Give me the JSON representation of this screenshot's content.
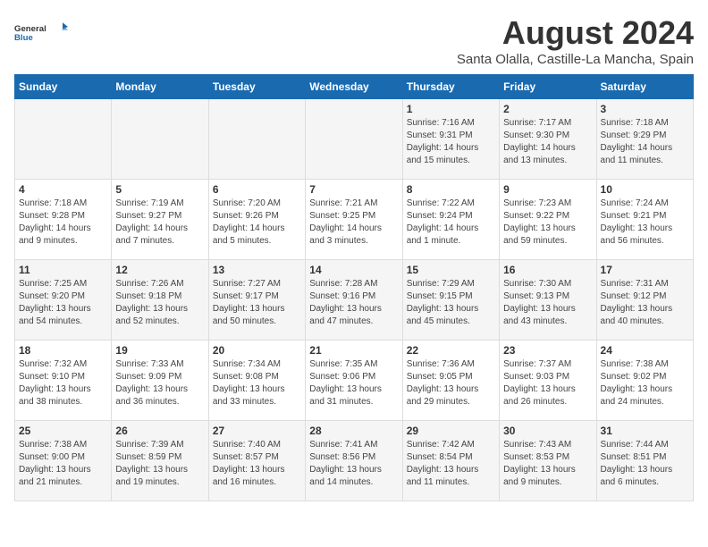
{
  "header": {
    "logo_general": "General",
    "logo_blue": "Blue",
    "month_year": "August 2024",
    "location": "Santa Olalla, Castille-La Mancha, Spain"
  },
  "days_of_week": [
    "Sunday",
    "Monday",
    "Tuesday",
    "Wednesday",
    "Thursday",
    "Friday",
    "Saturday"
  ],
  "weeks": [
    [
      {
        "day": "",
        "info": ""
      },
      {
        "day": "",
        "info": ""
      },
      {
        "day": "",
        "info": ""
      },
      {
        "day": "",
        "info": ""
      },
      {
        "day": "1",
        "info": "Sunrise: 7:16 AM\nSunset: 9:31 PM\nDaylight: 14 hours and 15 minutes."
      },
      {
        "day": "2",
        "info": "Sunrise: 7:17 AM\nSunset: 9:30 PM\nDaylight: 14 hours and 13 minutes."
      },
      {
        "day": "3",
        "info": "Sunrise: 7:18 AM\nSunset: 9:29 PM\nDaylight: 14 hours and 11 minutes."
      }
    ],
    [
      {
        "day": "4",
        "info": "Sunrise: 7:18 AM\nSunset: 9:28 PM\nDaylight: 14 hours and 9 minutes."
      },
      {
        "day": "5",
        "info": "Sunrise: 7:19 AM\nSunset: 9:27 PM\nDaylight: 14 hours and 7 minutes."
      },
      {
        "day": "6",
        "info": "Sunrise: 7:20 AM\nSunset: 9:26 PM\nDaylight: 14 hours and 5 minutes."
      },
      {
        "day": "7",
        "info": "Sunrise: 7:21 AM\nSunset: 9:25 PM\nDaylight: 14 hours and 3 minutes."
      },
      {
        "day": "8",
        "info": "Sunrise: 7:22 AM\nSunset: 9:24 PM\nDaylight: 14 hours and 1 minute."
      },
      {
        "day": "9",
        "info": "Sunrise: 7:23 AM\nSunset: 9:22 PM\nDaylight: 13 hours and 59 minutes."
      },
      {
        "day": "10",
        "info": "Sunrise: 7:24 AM\nSunset: 9:21 PM\nDaylight: 13 hours and 56 minutes."
      }
    ],
    [
      {
        "day": "11",
        "info": "Sunrise: 7:25 AM\nSunset: 9:20 PM\nDaylight: 13 hours and 54 minutes."
      },
      {
        "day": "12",
        "info": "Sunrise: 7:26 AM\nSunset: 9:18 PM\nDaylight: 13 hours and 52 minutes."
      },
      {
        "day": "13",
        "info": "Sunrise: 7:27 AM\nSunset: 9:17 PM\nDaylight: 13 hours and 50 minutes."
      },
      {
        "day": "14",
        "info": "Sunrise: 7:28 AM\nSunset: 9:16 PM\nDaylight: 13 hours and 47 minutes."
      },
      {
        "day": "15",
        "info": "Sunrise: 7:29 AM\nSunset: 9:15 PM\nDaylight: 13 hours and 45 minutes."
      },
      {
        "day": "16",
        "info": "Sunrise: 7:30 AM\nSunset: 9:13 PM\nDaylight: 13 hours and 43 minutes."
      },
      {
        "day": "17",
        "info": "Sunrise: 7:31 AM\nSunset: 9:12 PM\nDaylight: 13 hours and 40 minutes."
      }
    ],
    [
      {
        "day": "18",
        "info": "Sunrise: 7:32 AM\nSunset: 9:10 PM\nDaylight: 13 hours and 38 minutes."
      },
      {
        "day": "19",
        "info": "Sunrise: 7:33 AM\nSunset: 9:09 PM\nDaylight: 13 hours and 36 minutes."
      },
      {
        "day": "20",
        "info": "Sunrise: 7:34 AM\nSunset: 9:08 PM\nDaylight: 13 hours and 33 minutes."
      },
      {
        "day": "21",
        "info": "Sunrise: 7:35 AM\nSunset: 9:06 PM\nDaylight: 13 hours and 31 minutes."
      },
      {
        "day": "22",
        "info": "Sunrise: 7:36 AM\nSunset: 9:05 PM\nDaylight: 13 hours and 29 minutes."
      },
      {
        "day": "23",
        "info": "Sunrise: 7:37 AM\nSunset: 9:03 PM\nDaylight: 13 hours and 26 minutes."
      },
      {
        "day": "24",
        "info": "Sunrise: 7:38 AM\nSunset: 9:02 PM\nDaylight: 13 hours and 24 minutes."
      }
    ],
    [
      {
        "day": "25",
        "info": "Sunrise: 7:38 AM\nSunset: 9:00 PM\nDaylight: 13 hours and 21 minutes."
      },
      {
        "day": "26",
        "info": "Sunrise: 7:39 AM\nSunset: 8:59 PM\nDaylight: 13 hours and 19 minutes."
      },
      {
        "day": "27",
        "info": "Sunrise: 7:40 AM\nSunset: 8:57 PM\nDaylight: 13 hours and 16 minutes."
      },
      {
        "day": "28",
        "info": "Sunrise: 7:41 AM\nSunset: 8:56 PM\nDaylight: 13 hours and 14 minutes."
      },
      {
        "day": "29",
        "info": "Sunrise: 7:42 AM\nSunset: 8:54 PM\nDaylight: 13 hours and 11 minutes."
      },
      {
        "day": "30",
        "info": "Sunrise: 7:43 AM\nSunset: 8:53 PM\nDaylight: 13 hours and 9 minutes."
      },
      {
        "day": "31",
        "info": "Sunrise: 7:44 AM\nSunset: 8:51 PM\nDaylight: 13 hours and 6 minutes."
      }
    ]
  ]
}
